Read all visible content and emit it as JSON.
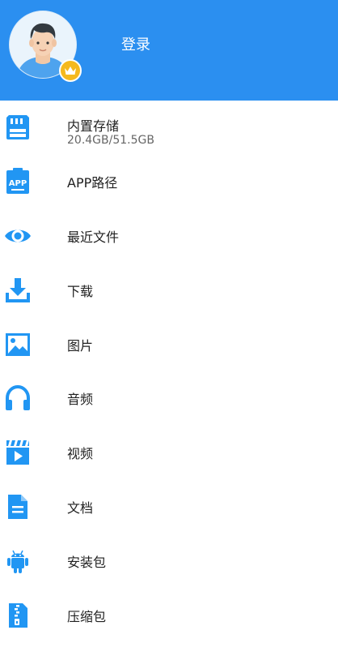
{
  "colors": {
    "accent": "#2b8ff0",
    "icon": "#2196f3",
    "crown": "#f5b91e"
  },
  "header": {
    "login_label": "登录"
  },
  "menu": [
    {
      "label": "内置存储",
      "sub": "20.4GB/51.5GB",
      "icon": "sd-card-icon"
    },
    {
      "label": "APP路径",
      "icon": "app-icon"
    },
    {
      "label": "最近文件",
      "icon": "eye-icon"
    },
    {
      "label": "下载",
      "icon": "download-icon"
    },
    {
      "label": "图片",
      "icon": "image-icon"
    },
    {
      "label": "音频",
      "icon": "headphones-icon"
    },
    {
      "label": "视频",
      "icon": "video-icon"
    },
    {
      "label": "文档",
      "icon": "document-icon"
    },
    {
      "label": "安装包",
      "icon": "android-icon"
    },
    {
      "label": "压缩包",
      "icon": "zip-icon"
    }
  ]
}
